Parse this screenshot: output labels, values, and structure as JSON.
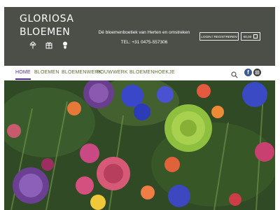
{
  "brand": {
    "line1": "GLORIOSA",
    "line2": "BLOEMEN",
    "icons": [
      "flower-icon",
      "gift-icon",
      "plant-icon"
    ]
  },
  "header": {
    "tagline": "Dé bloemenboetiek van Herten en omstreken",
    "phone": "TEL: +31 0475-557306",
    "login_label": "LOGIN / REGISTREREN",
    "cart_label": "€0,00",
    "colors": {
      "topbar": "#4b4f48",
      "nav_text": "#5a6b37",
      "nav_active": "#4f2d8c"
    }
  },
  "nav": {
    "items": [
      {
        "label": "HOME",
        "active": true
      },
      {
        "label": "BLOEMEN",
        "active": false
      },
      {
        "label": "BLOEMENWERK",
        "active": false
      },
      {
        "label": "ROUWWERK",
        "active": false
      },
      {
        "label": "BLOEMENHOEKJE",
        "active": false
      }
    ],
    "icons": [
      "search-icon",
      "facebook-icon",
      "instagram-icon"
    ]
  }
}
